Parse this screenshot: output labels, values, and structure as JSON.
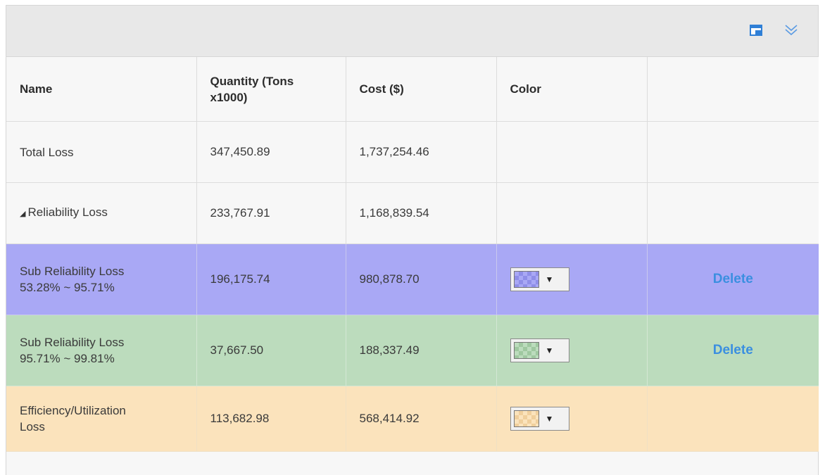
{
  "toolbar": {
    "icons": [
      "window-icon",
      "collapse-chevrons-icon"
    ],
    "accent_color": "#3b8fe0"
  },
  "table": {
    "columns": [
      "Name",
      "Quantity (Tons x1000)",
      "Cost ($)",
      "Color",
      ""
    ],
    "rows": [
      {
        "name": "Total Loss",
        "name_line2": "",
        "quantity": "347,450.89",
        "cost": "1,737,254.46",
        "has_color": false,
        "action": "",
        "bg": "#f7f7f7"
      },
      {
        "name": "Reliability Loss",
        "name_line2": "",
        "quantity": "233,767.91",
        "cost": "1,168,839.54",
        "has_color": false,
        "action": "",
        "bg": "#f7f7f7",
        "expanded": true
      },
      {
        "name": "Sub Reliability Loss",
        "name_line2": "53.28% ~ 95.71%",
        "quantity": "196,175.74",
        "cost": "980,878.70",
        "has_color": true,
        "swatch": "#a9a8f5",
        "action": "Delete",
        "bg": "#a9a8f5"
      },
      {
        "name": "Sub Reliability Loss",
        "name_line2": "95.71% ~ 99.81%",
        "quantity": "37,667.50",
        "cost": "188,337.49",
        "has_color": true,
        "swatch": "#bcdcbd",
        "action": "Delete",
        "bg": "#bcdcbd"
      },
      {
        "name": "Efficiency/Utilization",
        "name_line2": "Loss",
        "quantity": "113,682.98",
        "cost": "568,414.92",
        "has_color": true,
        "swatch": "#fbe3bc",
        "action": "",
        "bg": "#fbe3bc"
      }
    ]
  }
}
